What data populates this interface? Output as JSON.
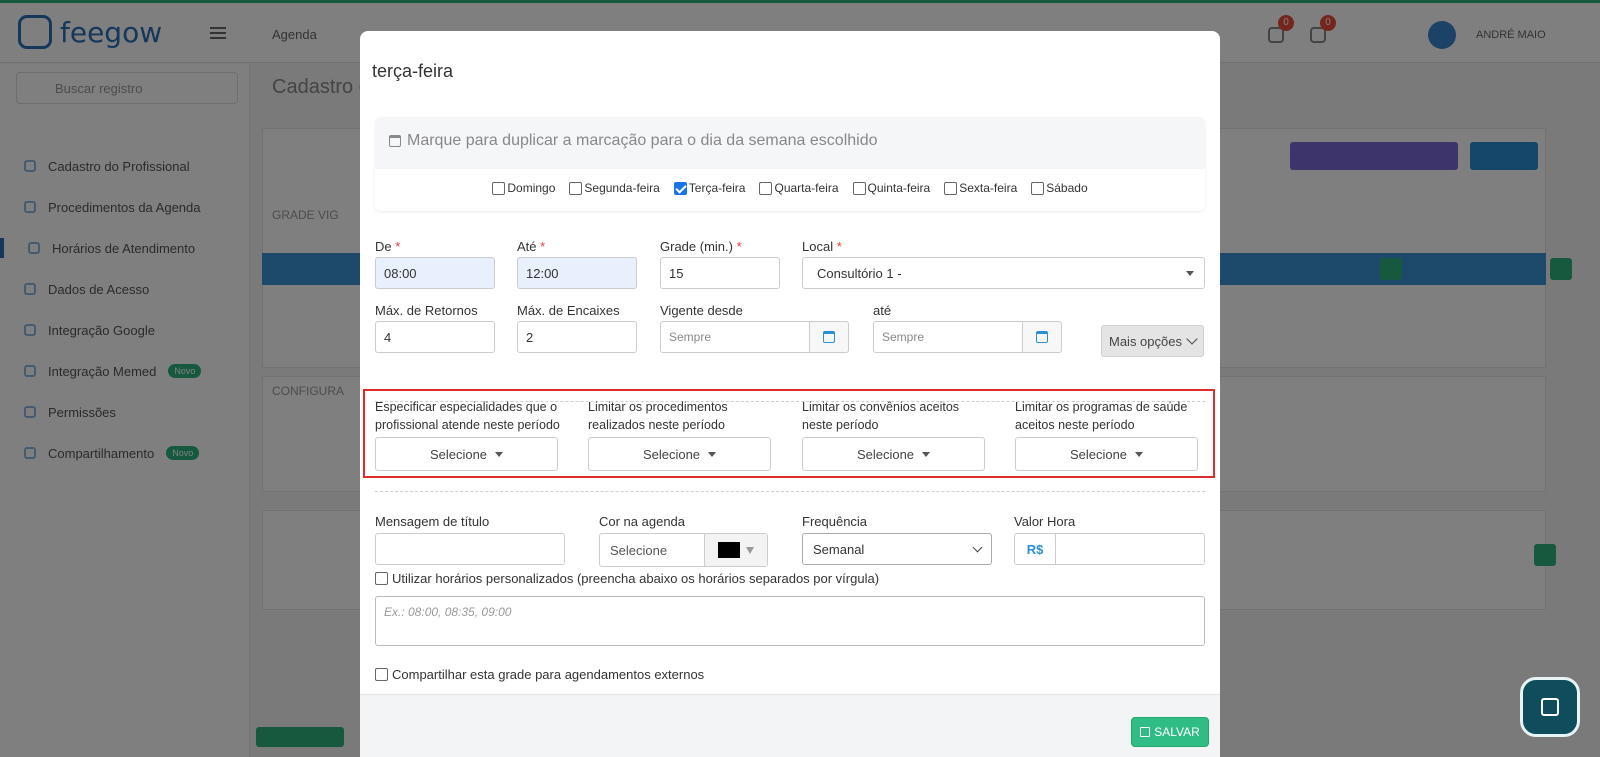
{
  "app": {
    "logo": "feegow",
    "top_menu": "Agenda",
    "user": "ANDRÉ MAIO",
    "notif_count_1": "0",
    "notif_count_2": "0"
  },
  "sidebar": {
    "search_placeholder": "Buscar registro",
    "items": [
      {
        "label": "Cadastro do Profissional"
      },
      {
        "label": "Procedimentos da Agenda"
      },
      {
        "label": "Horários de Atendimento"
      },
      {
        "label": "Dados de Acesso"
      },
      {
        "label": "Integração Google"
      },
      {
        "label": "Integração Memed",
        "badge": "Novo"
      },
      {
        "label": "Permissões"
      },
      {
        "label": "Compartilhamento",
        "badge": "Novo"
      }
    ]
  },
  "background": {
    "page_title": "Cadastro d",
    "grade_title": "GRADE VIG",
    "config_title": "CONFIGURA"
  },
  "modal": {
    "title": "terça-feira",
    "duplicate_header": "Marque para duplicar a marcação para o dia da semana escolhido",
    "days": [
      {
        "label": "Domingo",
        "checked": false
      },
      {
        "label": "Segunda-feira",
        "checked": false
      },
      {
        "label": "Terça-feira",
        "checked": true
      },
      {
        "label": "Quarta-feira",
        "checked": false
      },
      {
        "label": "Quinta-feira",
        "checked": false
      },
      {
        "label": "Sexta-feira",
        "checked": false
      },
      {
        "label": "Sábado",
        "checked": false
      }
    ],
    "fields": {
      "de_label": "De",
      "de_value": "08:00",
      "ate_label": "Até",
      "ate_value": "12:00",
      "grade_label": "Grade (min.)",
      "grade_value": "15",
      "local_label": "Local",
      "local_value": "Consultório 1 -",
      "max_retornos_label": "Máx. de Retornos",
      "max_retornos_value": "4",
      "max_encaixes_label": "Máx. de Encaixes",
      "max_encaixes_value": "2",
      "vigente_label": "Vigente desde",
      "vigente_placeholder": "Sempre",
      "ate2_label": "até",
      "ate2_placeholder": "Sempre",
      "mais_opcoes": "Mais opções"
    },
    "limits": [
      {
        "label": "Especificar especialidades que o profissional atende neste período",
        "button": "Selecione"
      },
      {
        "label": "Limitar os procedimentos realizados neste período",
        "button": "Selecione"
      },
      {
        "label": "Limitar os convênios aceitos neste período",
        "button": "Selecione"
      },
      {
        "label": "Limitar os programas de saúde aceitos neste período",
        "button": "Selecione"
      }
    ],
    "lower": {
      "mensagem_label": "Mensagem de título",
      "cor_label": "Cor na agenda",
      "cor_value": "Selecione",
      "cor_swatch": "#000000",
      "frequencia_label": "Frequência",
      "frequencia_value": "Semanal",
      "valor_label": "Valor Hora",
      "valor_prefix": "R$",
      "custom_hours_label": "Utilizar horários personalizados (preencha abaixo os horários separados por vírgula)",
      "custom_hours_placeholder": "Ex.: 08:00, 08:35, 09:00",
      "share_label": "Compartilhar esta grade para agendamentos externos"
    },
    "save_button": "SALVAR"
  },
  "colors": {
    "accent_blue": "#2b8fd6",
    "save_green": "#2fbd84",
    "highlight_red": "#e12b2b"
  }
}
